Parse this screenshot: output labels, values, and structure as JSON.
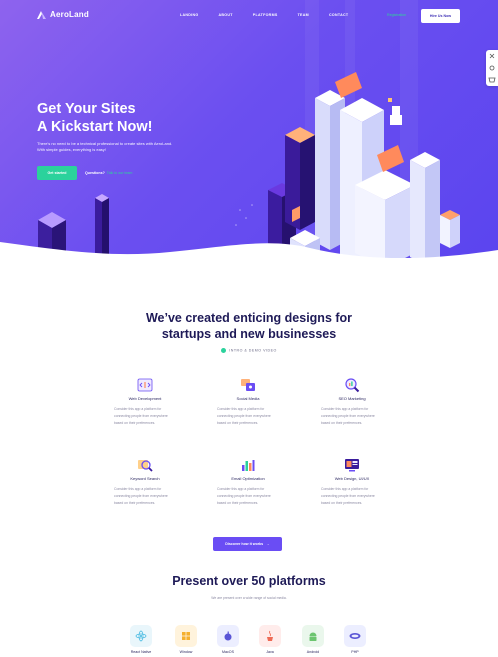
{
  "nav": {
    "logo": "AeroLand",
    "links": [
      "LANDING",
      "ABOUT",
      "PLATFORMS",
      "TEAM",
      "CONTACT"
    ],
    "register_label": "Registration",
    "hire_label": "Hire Us Now"
  },
  "hero": {
    "title_line1": "Get Your Sites",
    "title_line2": "A Kickstart Now!",
    "subtitle": "There's no need to be a technical professional to create sites with AeroLand. With simple guides, everything is easy!",
    "cta_label": "Get started",
    "questions_label": "Questions?",
    "questions_link": "Talk to our team"
  },
  "section1": {
    "title_line1": "We’ve created enticing designs for",
    "title_line2": "startups and new businesses",
    "video_label": "INTRO & DEMO VIDEO",
    "features": [
      {
        "title": "Web Development",
        "text": "Consider this app a platform for connecting people from everywhere based on their preferences.",
        "icon": "code-window-icon"
      },
      {
        "title": "Social Media",
        "text": "Consider this app a platform for connecting people from everywhere based on their preferences.",
        "icon": "social-chat-icon"
      },
      {
        "title": "SEO Marketing",
        "text": "Consider this app a platform for connecting people from everywhere based on their preferences.",
        "icon": "seo-magnifier-icon"
      },
      {
        "title": "Keyword Search",
        "text": "Consider this app a platform for connecting people from everywhere based on their preferences.",
        "icon": "keyword-search-icon"
      },
      {
        "title": "Email Optimization",
        "text": "Consider this app a platform for connecting people from everywhere based on their preferences.",
        "icon": "email-chart-icon"
      },
      {
        "title": "Web Design, UI/UX",
        "text": "Consider this app a platform for connecting people from everywhere based on their preferences.",
        "icon": "web-design-icon"
      }
    ],
    "discover_label": "Discover how it works"
  },
  "section2": {
    "title": "Present over 50 platforms",
    "subtitle": "We are present over a wide range of social media.",
    "platforms": [
      {
        "name": "React Native",
        "icon": "react-icon",
        "bg": "#e9f6fb",
        "fg": "#3cb6e0"
      },
      {
        "name": "Window",
        "icon": "windows-icon",
        "bg": "#fff3dc",
        "fg": "#f5b02e"
      },
      {
        "name": "MacOS",
        "icon": "apple-icon",
        "bg": "#eceeff",
        "fg": "#5a55d6"
      },
      {
        "name": "Java",
        "icon": "java-icon",
        "bg": "#ffeceb",
        "fg": "#ee6a55"
      },
      {
        "name": "Android",
        "icon": "android-icon",
        "bg": "#eaf7ec",
        "fg": "#6cc56f"
      },
      {
        "name": "PHP",
        "icon": "php-icon",
        "bg": "#eceeff",
        "fg": "#5a55d6"
      }
    ]
  },
  "colors": {
    "accent_purple": "#6a4df4",
    "accent_green": "#2bd29c",
    "heading": "#1e1a57",
    "body_text": "#8c8aa3"
  }
}
